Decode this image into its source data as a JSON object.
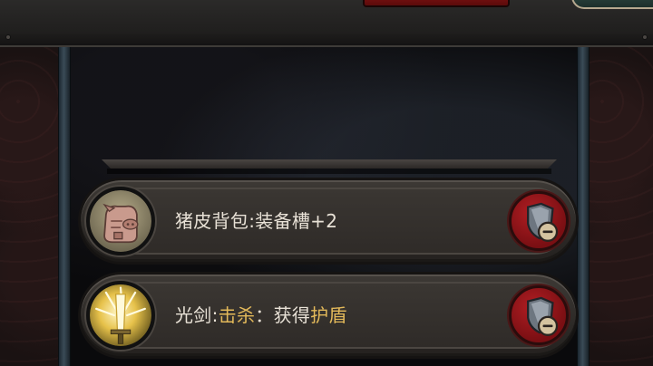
{
  "items": [
    {
      "name": "猪皮背包",
      "separator": ":",
      "effect_plain": "装备槽+2",
      "icon": "pig-leather-backpack-icon",
      "action_icon": "shield-minus-icon"
    },
    {
      "name": "光剑",
      "separator": ":",
      "effect_trigger": "击杀",
      "effect_mid": "：获得",
      "effect_result": "护盾",
      "icon": "light-sword-icon",
      "action_icon": "shield-minus-icon"
    }
  ],
  "colors": {
    "highlight": "#e3b95a",
    "text": "#e8e1d6",
    "remove_button": "#b11e23"
  }
}
